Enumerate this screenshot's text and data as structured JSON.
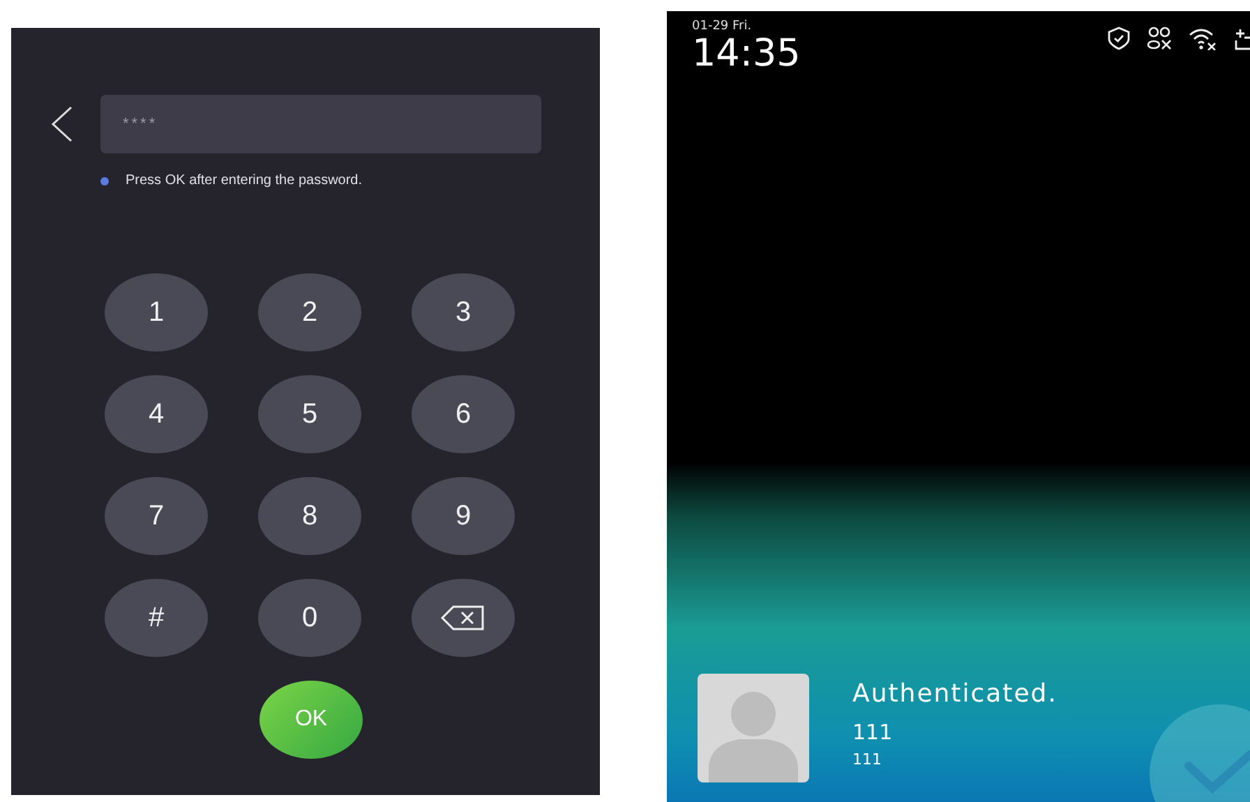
{
  "password_screen": {
    "password_field": {
      "value": "****"
    },
    "hint": "Press OK after entering the password.",
    "keys": [
      {
        "kind": "digit",
        "label": "1"
      },
      {
        "kind": "digit",
        "label": "2"
      },
      {
        "kind": "digit",
        "label": "3"
      },
      {
        "kind": "digit",
        "label": "4"
      },
      {
        "kind": "digit",
        "label": "5"
      },
      {
        "kind": "digit",
        "label": "6"
      },
      {
        "kind": "digit",
        "label": "7"
      },
      {
        "kind": "digit",
        "label": "8"
      },
      {
        "kind": "digit",
        "label": "9"
      },
      {
        "kind": "digit",
        "label": "#"
      },
      {
        "kind": "digit",
        "label": "0"
      },
      {
        "kind": "backspace"
      }
    ],
    "ok_button": "OK"
  },
  "result_screen": {
    "date": "01-29 Fri.",
    "time": "14:35",
    "message": "Authenticated.",
    "name": "111",
    "id": "111"
  }
}
